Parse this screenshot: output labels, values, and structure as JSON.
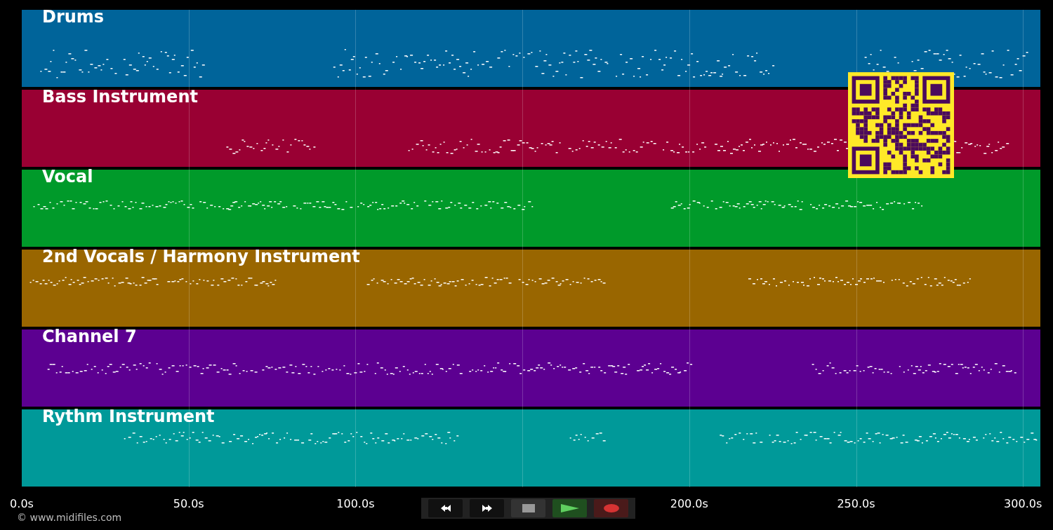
{
  "tracks": [
    {
      "name": "Drums",
      "color": "#00649a"
    },
    {
      "name": "Bass Instrument",
      "color": "#990033"
    },
    {
      "name": "Vocal",
      "color": "#009a2a"
    },
    {
      "name": "2nd Vocals / Harmony Instrument",
      "color": "#996600"
    },
    {
      "name": "Channel 7",
      "color": "#5c0091"
    },
    {
      "name": "Rythm Instrument",
      "color": "#009999"
    }
  ],
  "time_axis": {
    "ticks": [
      "0.0s",
      "50.0s",
      "100.0s",
      "200.0s",
      "250.0s",
      "300.0s"
    ]
  },
  "transport": [
    {
      "kind": "rewind"
    },
    {
      "kind": "forward"
    },
    {
      "kind": "stop"
    },
    {
      "kind": "play"
    },
    {
      "kind": "record"
    }
  ],
  "copyright": "© www.midifiles.com"
}
